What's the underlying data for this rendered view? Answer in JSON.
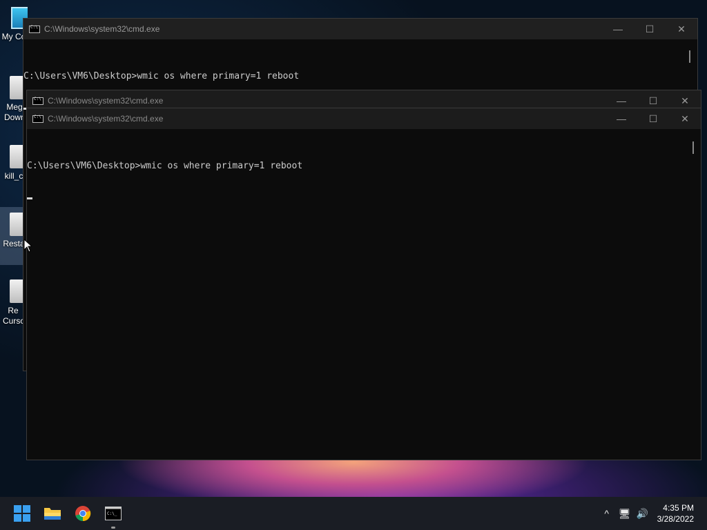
{
  "desktop": {
    "icons": [
      {
        "label": "My Co",
        "icon": "computer-icon"
      },
      {
        "label": "Meg Down",
        "icon": "file-icon"
      },
      {
        "label": "kill_c",
        "icon": "file-icon"
      },
      {
        "label": "Resta",
        "icon": "file-icon"
      },
      {
        "label": "Re Curso",
        "icon": "file-icon"
      }
    ]
  },
  "windows": {
    "back": {
      "title": "C:\\Windows\\system32\\cmd.exe",
      "line": "C:\\Users\\VM6\\Desktop>wmic os where primary=1 reboot"
    },
    "middle": {
      "title": "C:\\Windows\\system32\\cmd.exe"
    },
    "front": {
      "title": "C:\\Windows\\system32\\cmd.exe",
      "line": "C:\\Users\\VM6\\Desktop>wmic os where primary=1 reboot"
    },
    "controls": {
      "minimize": "—",
      "maximize": "☐",
      "close": "✕"
    }
  },
  "taskbar": {
    "apps": [
      "start-icon",
      "file-explorer-icon",
      "chrome-icon",
      "cmd-icon"
    ],
    "tray": {
      "chevron": "^",
      "network": "🖥",
      "volume": "🔊"
    },
    "clock": {
      "time": "4:35 PM",
      "date": "3/28/2022"
    }
  },
  "colors": {
    "console_bg": "#0c0c0c",
    "titlebar_bg": "#202020",
    "taskbar_bg": "#1a1d24"
  }
}
